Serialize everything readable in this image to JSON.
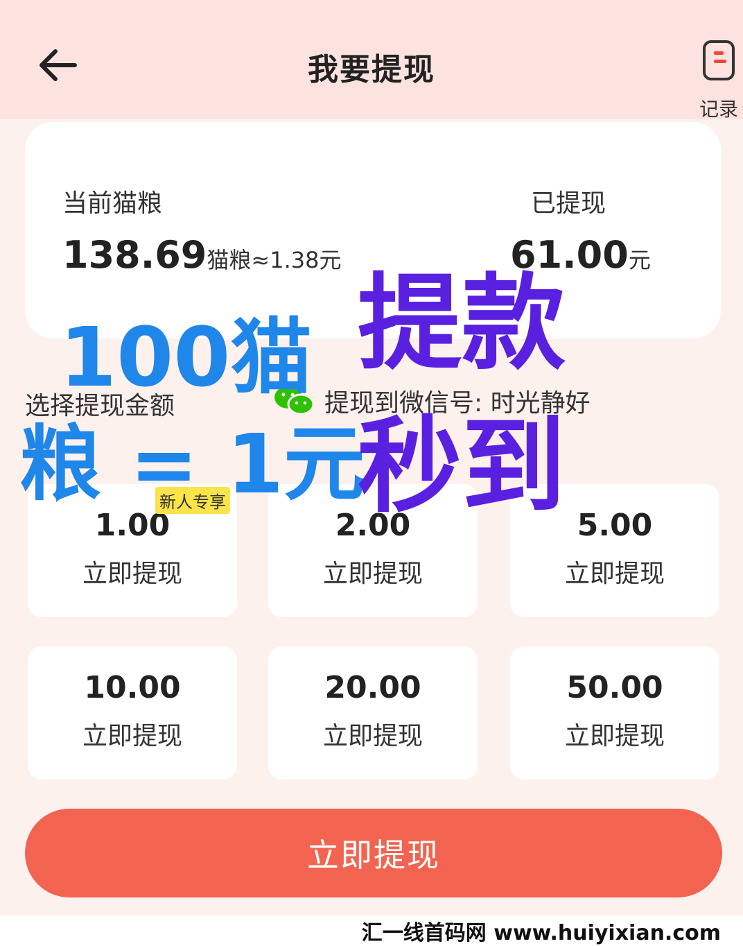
{
  "header": {
    "title": "我要提现",
    "record_label": "记录"
  },
  "balance": {
    "current_label": "当前猫粮",
    "current_value": "138.69",
    "current_unit": "猫粮≈1.38元",
    "withdrawn_label": "已提现",
    "withdrawn_value": "61.00",
    "withdrawn_unit": "元"
  },
  "select_label": "选择提现金额",
  "wechat_target": "提现到微信号: 时光静好",
  "amount_options": [
    {
      "value": "1.00",
      "action": "立即提现",
      "badge": "新人专享"
    },
    {
      "value": "2.00",
      "action": "立即提现"
    },
    {
      "value": "5.00",
      "action": "立即提现"
    },
    {
      "value": "10.00",
      "action": "立即提现"
    },
    {
      "value": "20.00",
      "action": "立即提现"
    },
    {
      "value": "50.00",
      "action": "立即提现"
    }
  ],
  "overlay": {
    "line1": "100猫",
    "line2": "粮 = 1元",
    "line3": "提款",
    "line4": "秒到"
  },
  "submit_label": "立即提现",
  "watermark": "汇一线首码网 www.huiyixian.com",
  "colors": {
    "header_bg": "#fde3df",
    "page_bg": "#fdf1ee",
    "accent": "#f26450",
    "overlay_blue": "#1f86ea",
    "overlay_purple": "#5a20e0",
    "badge_bg": "#fbe34a"
  },
  "icons": {
    "back": "arrow-left-icon",
    "record": "document-icon",
    "wechat": "wechat-icon"
  }
}
